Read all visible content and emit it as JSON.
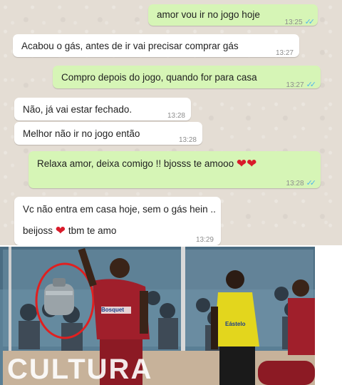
{
  "messages": [
    {
      "text": "amor vou ir no jogo hoje",
      "time": "13:25",
      "ticks": "✓✓"
    },
    {
      "text": "Acabou o gás, antes de ir vai precisar comprar gás",
      "time": "13:27"
    },
    {
      "text": "Compro depois do jogo, quando for para casa",
      "time": "13:27",
      "ticks": "✓✓"
    },
    {
      "text": "Não, já vai estar fechado.",
      "time": "13:28"
    },
    {
      "text": "Melhor não ir no jogo então",
      "time": "13:28"
    },
    {
      "text": "Relaxa amor, deixa comigo !!  bjosss te amooo",
      "hearts": "❤❤",
      "time": "13:28",
      "ticks": "✓✓"
    },
    {
      "line1": "Vc não entra em casa hoje, sem o gás hein ..",
      "line2_a": "beijoss",
      "heart": "❤",
      "line2_b": "tbm te amo",
      "time": "13:29"
    }
  ],
  "photo": {
    "banner_text": "CULTURA",
    "jersey_text": "Bosquet",
    "referee_text": "Eástelo"
  },
  "colors": {
    "incoming": "#ffffff",
    "outgoing": "#d6f5b6",
    "read_ticks": "#4fb6ec",
    "circle": "#e02020"
  }
}
